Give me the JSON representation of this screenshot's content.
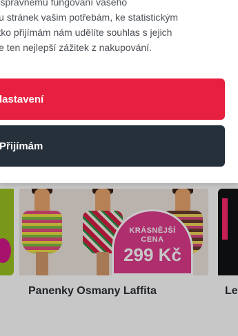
{
  "consent": {
    "text_lines": [
      "kie ke správnému fungování vašeho",
      "obsahu stránek vašim potřebám, ke statistickým",
      "a tlačítko přijímám nám udělíte souhlas s jejich",
      "ytneme ten nejlepší zážitek z nakupování."
    ],
    "settings_button": "lastavení",
    "accept_button": "Přijímám"
  },
  "products": {
    "main": {
      "title": "Panenky Osmany Laffita",
      "badge_line1": "KRÁSNĚJŠÍ",
      "badge_line2": "CENA",
      "badge_price": "299 Kč"
    },
    "right": {
      "title_fragment": "Le"
    },
    "left": {
      "image_label": "left-product-image"
    }
  },
  "colors": {
    "settings_button": "#e8203f",
    "accept_button": "#25303b",
    "price_badge": "#df3b8e",
    "overlay": "rgba(0,0,0,0.22)"
  }
}
